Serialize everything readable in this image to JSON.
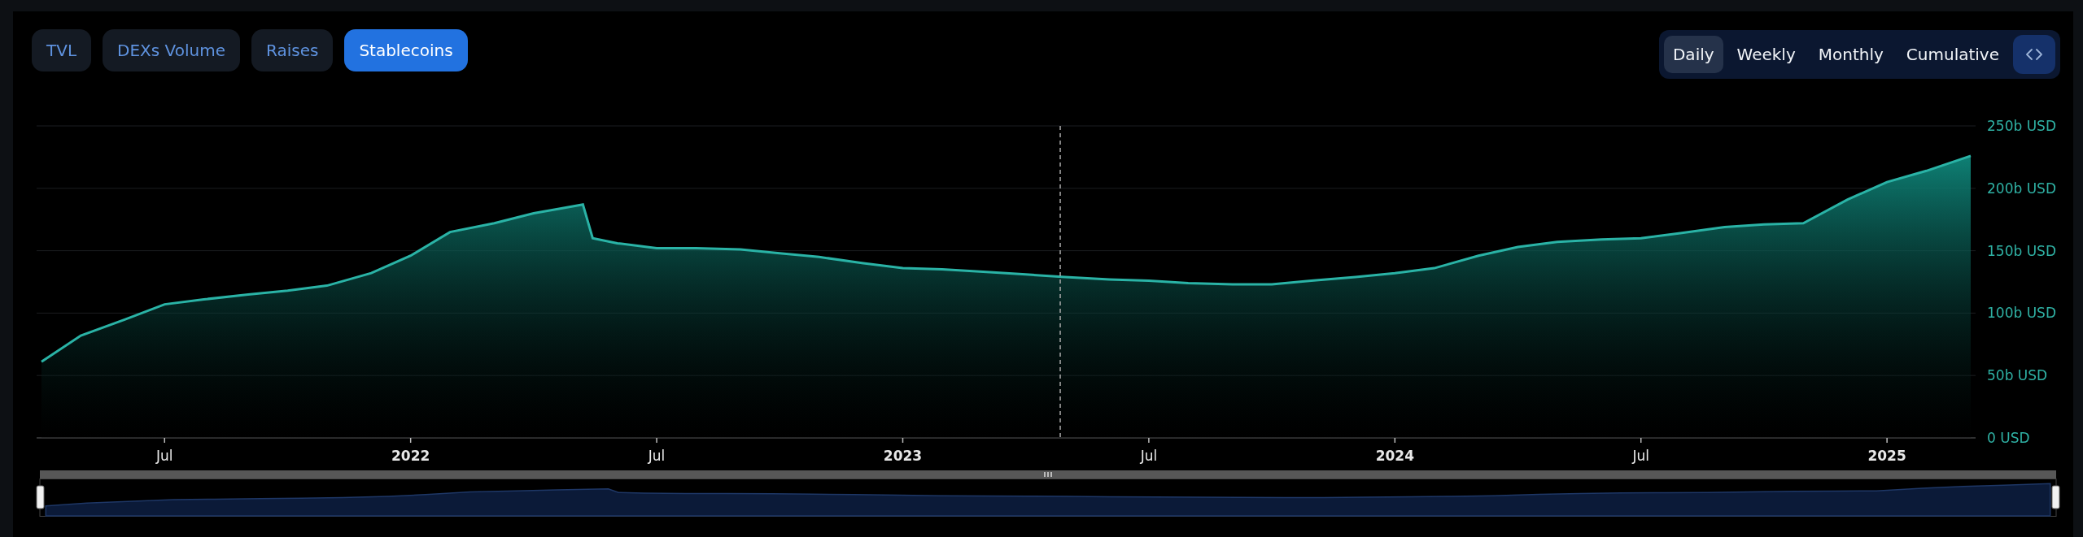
{
  "tabs": [
    {
      "label": "TVL",
      "selected": false
    },
    {
      "label": "DEXs Volume",
      "selected": false
    },
    {
      "label": "Raises",
      "selected": false
    },
    {
      "label": "Stablecoins",
      "selected": true
    }
  ],
  "periods": [
    {
      "label": "Daily",
      "selected": true
    },
    {
      "label": "Weekly",
      "selected": false
    },
    {
      "label": "Monthly",
      "selected": false
    },
    {
      "label": "Cumulative",
      "selected": false
    }
  ],
  "chart": {
    "chart_data": {
      "type": "area",
      "x": [
        2021.25,
        2021.33,
        2021.42,
        2021.5,
        2021.58,
        2021.67,
        2021.75,
        2021.83,
        2021.92,
        2022,
        2022.08,
        2022.17,
        2022.25,
        2022.35,
        2022.37,
        2022.42,
        2022.5,
        2022.58,
        2022.67,
        2022.75,
        2022.83,
        2022.92,
        2023,
        2023.08,
        2023.17,
        2023.25,
        2023.33,
        2023.42,
        2023.5,
        2023.58,
        2023.67,
        2023.75,
        2023.83,
        2023.92,
        2024,
        2024.08,
        2024.17,
        2024.25,
        2024.33,
        2024.42,
        2024.5,
        2024.58,
        2024.67,
        2024.75,
        2024.83,
        2024.92,
        2025,
        2025.08,
        2025.17
      ],
      "series": [
        {
          "color": "#2ab3a6",
          "values": [
            61,
            82,
            95,
            107,
            111,
            115,
            118,
            122,
            132,
            146,
            165,
            172,
            180,
            187,
            160,
            156,
            152,
            152,
            151,
            148,
            145,
            140,
            136,
            135,
            133,
            131,
            129,
            127,
            126,
            124,
            123,
            123,
            126,
            129,
            132,
            136,
            146,
            153,
            157,
            159,
            160,
            164,
            169,
            171,
            172,
            191,
            205,
            214,
            226
          ]
        }
      ],
      "xlim": [
        2021.24,
        2025.18
      ],
      "ylim": [
        0,
        250
      ],
      "grid": true,
      "ref_lines": [
        {
          "axis": "x",
          "value": 2023.32
        }
      ],
      "xticks": [
        {
          "value": 2021.5,
          "label": "Jul"
        },
        {
          "value": 2022,
          "label": "2022"
        },
        {
          "value": 2022.5,
          "label": "Jul"
        },
        {
          "value": 2023,
          "label": "2023"
        },
        {
          "value": 2023.5,
          "label": "Jul"
        },
        {
          "value": 2024,
          "label": "2024"
        },
        {
          "value": 2024.5,
          "label": "Jul"
        },
        {
          "value": 2025,
          "label": "2025"
        }
      ],
      "yticks": [
        {
          "value": 0,
          "label": "0 USD"
        },
        {
          "value": 50,
          "label": "50b USD"
        },
        {
          "value": 100,
          "label": "100b USD"
        },
        {
          "value": 150,
          "label": "150b USD"
        },
        {
          "value": 200,
          "label": "200b USD"
        },
        {
          "value": 250,
          "label": "250b USD"
        }
      ]
    }
  }
}
